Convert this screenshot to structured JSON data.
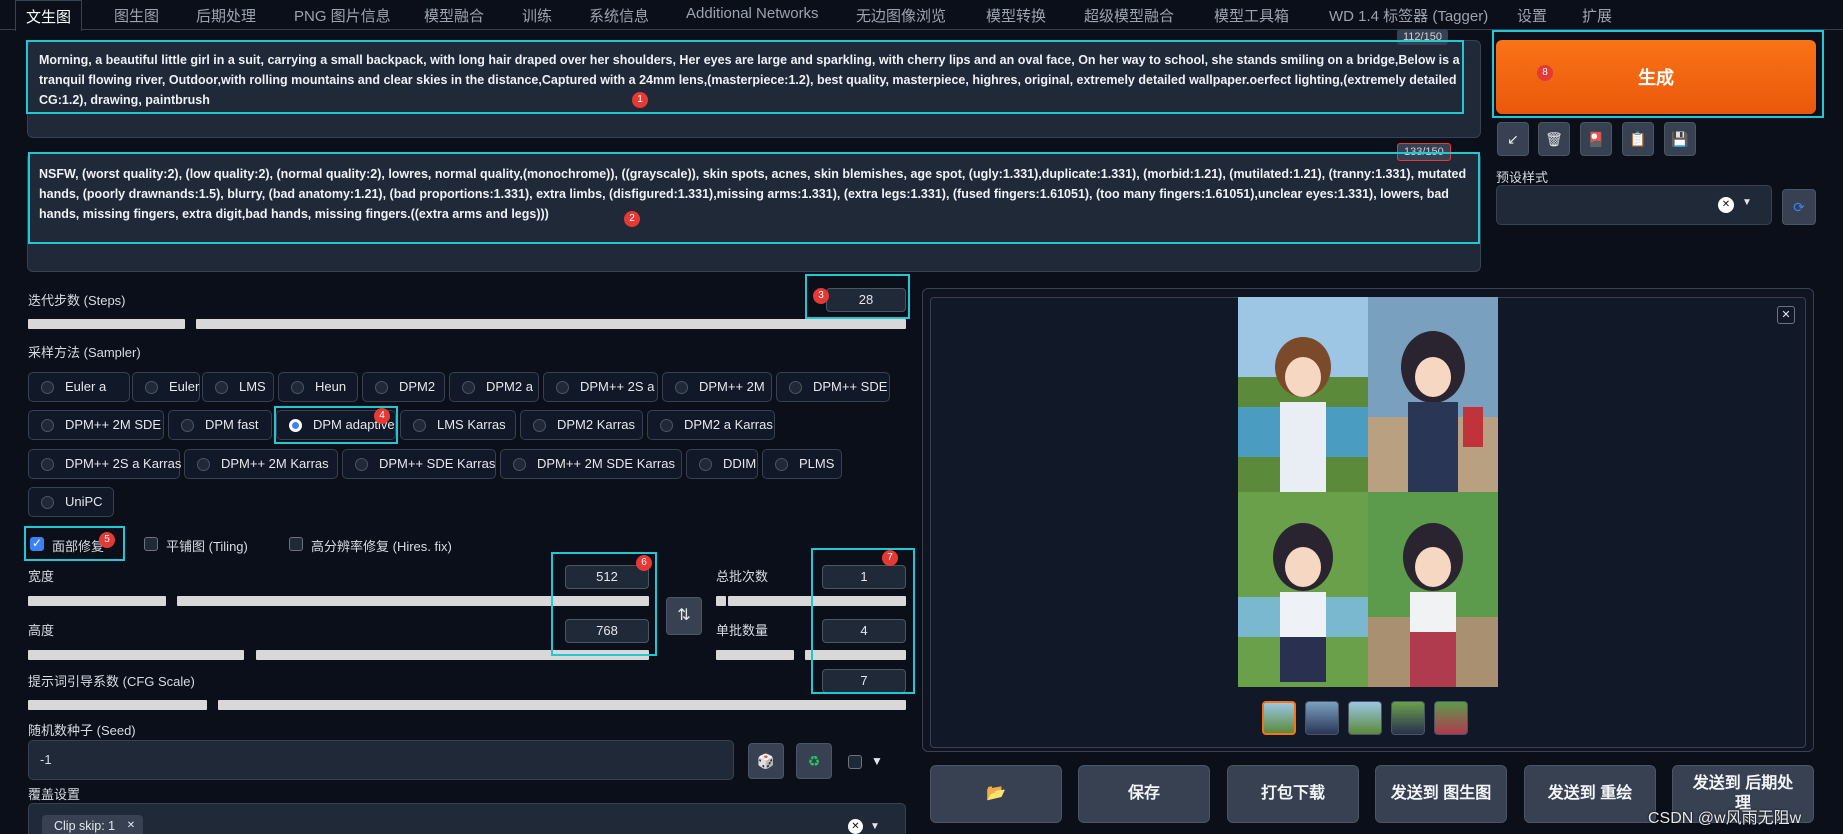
{
  "tabs": [
    "文生图",
    "图生图",
    "后期处理",
    "PNG 图片信息",
    "模型融合",
    "训练",
    "系统信息",
    "Additional Networks",
    "无边图像浏览",
    "模型转换",
    "超级模型融合",
    "模型工具箱",
    "WD 1.4 标签器 (Tagger)",
    "设置",
    "扩展"
  ],
  "prompt": {
    "text": "Morning, a beautiful little girl in a suit, carrying a small backpack, with long hair draped over her shoulders, Her eyes are large and sparkling, with cherry lips and an oval face, On her way to school, she stands smiling on a bridge,Below is a tranquil flowing river, Outdoor,with rolling mountains and clear skies in the distance,Captured with a 24mm lens,(masterpiece:1.2), best quality, masterpiece, highres, original, extremely detailed wallpaper.oerfect lighting,(extremely detailed CG:1.2), drawing, paintbrush",
    "counter": "112/150"
  },
  "negative": {
    "text": "NSFW, (worst quality:2), (low quality:2), (normal quality:2), lowres, normal quality,(monochrome)), ((grayscale)), skin spots, acnes, skin blemishes, age spot, (ugly:1.331),duplicate:1.331), (morbid:1.21), (mutilated:1.21), (tranny:1.331), mutated hands, (poorly drawnands:1.5), blurry, (bad anatomy:1.21), (bad proportions:1.331), extra limbs, (disfigured:1.331),missing arms:1.331), (extra legs:1.331), (fused fingers:1.61051), (too many fingers:1.61051),unclear eyes:1.331), lowers, bad hands, missing fingers, extra digit,bad hands, missing fingers.((extra arms and legs)))",
    "counter": "133/150"
  },
  "markers": [
    "1",
    "2",
    "3",
    "4",
    "5",
    "6",
    "7",
    "8"
  ],
  "steps": {
    "label": "迭代步数 (Steps)",
    "value": "28",
    "fraction": 0.28
  },
  "sampler": {
    "label": "采样方法 (Sampler)",
    "selected": "DPM adaptive",
    "options": [
      "Euler a",
      "Euler",
      "LMS",
      "Heun",
      "DPM2",
      "DPM2 a",
      "DPM++ 2S a",
      "DPM++ 2M",
      "DPM++ SDE",
      "DPM++ 2M SDE",
      "DPM fast",
      "DPM adaptive",
      "LMS Karras",
      "DPM2 Karras",
      "DPM2 a Karras",
      "DPM++ 2S a Karras",
      "DPM++ 2M Karras",
      "DPM++ SDE Karras",
      "DPM++ 2M SDE Karras",
      "DDIM",
      "PLMS",
      "UniPC"
    ]
  },
  "checks": {
    "face_restore": "面部修复",
    "tiling": "平铺图 (Tiling)",
    "hires": "高分辨率修复 (Hires. fix)"
  },
  "width": {
    "label": "宽度",
    "value": "512"
  },
  "height": {
    "label": "高度",
    "value": "768"
  },
  "batch_count": {
    "label": "总批次数",
    "value": "1"
  },
  "batch_size": {
    "label": "单批数量",
    "value": "4"
  },
  "cfg": {
    "label": "提示词引导系数 (CFG Scale)",
    "value": "7"
  },
  "seed": {
    "label": "随机数种子 (Seed)",
    "value": "-1"
  },
  "override": {
    "label": "覆盖设置",
    "chip": "Clip skip: 1"
  },
  "generate": {
    "label": "生成"
  },
  "style": {
    "label": "预设样式"
  },
  "output_buttons": [
    "📂",
    "保存",
    "打包下载",
    "发送到 图生图",
    "发送到 重绘",
    "发送到 后期处理"
  ],
  "watermark": "CSDN @w风雨无阻w",
  "colors": {
    "accent": "#ea580c",
    "highlight": "#1fc8d4",
    "marker": "#e53935",
    "bg": "#0b0f19"
  }
}
